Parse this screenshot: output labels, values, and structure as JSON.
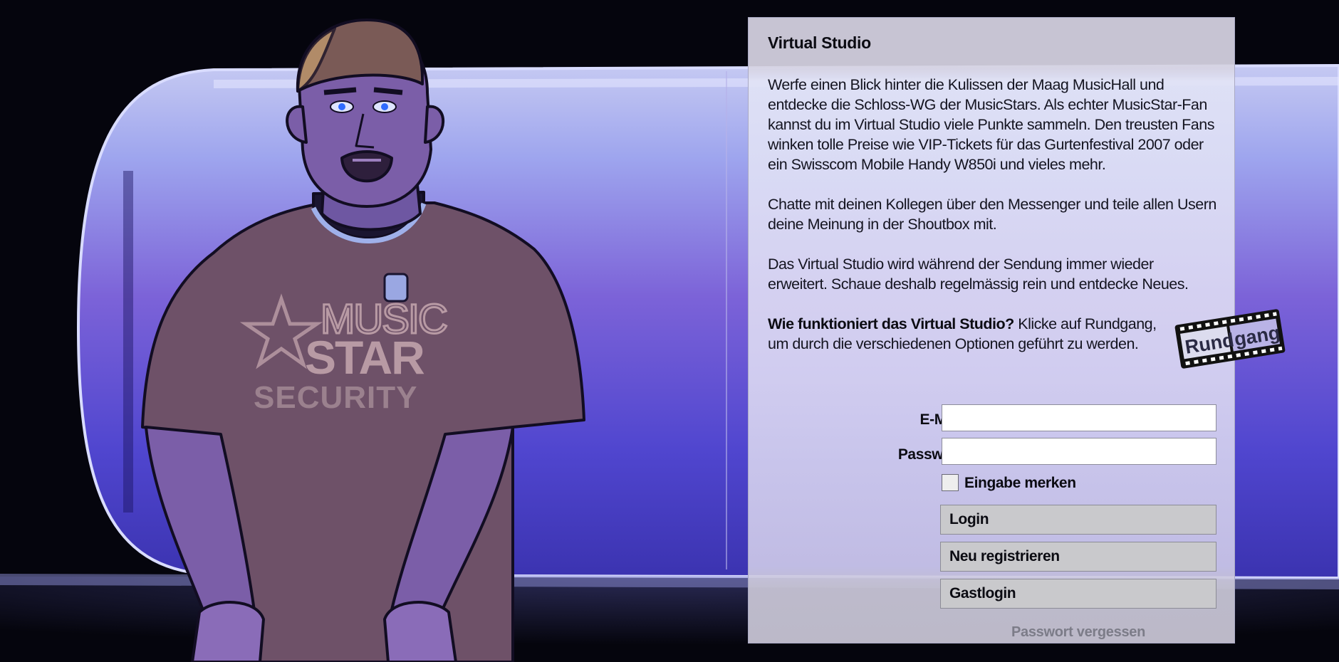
{
  "panel": {
    "title": "Virtual Studio",
    "intro_paragraphs": [
      "Werfe einen Blick hinter die Kulissen der Maag MusicHall und entdecke die Schloss-WG der MusicStars. Als echter MusicStar-Fan kannst du im Virtual Studio viele Punkte sammeln. Den treusten Fans winken tolle Preise wie VIP-Tickets für das Gurtenfestival 2007 oder ein Swisscom Mobile Handy W850i und vieles mehr.",
      "Chatte mit deinen Kollegen über den Messenger und teile allen Usern deine Meinung in der Shoutbox mit.",
      "Das Virtual Studio wird während der Sendung immer wieder erweitert. Schaue deshalb regelmässig rein und entdecke Neues."
    ],
    "howto_question": "Wie funktioniert das Virtual Studio?",
    "howto_text": " Klicke auf  Rundgang, um durch die verschiedenen Optionen geführt zu werden.",
    "rundgang_label_left": "Rund",
    "rundgang_label_right": "gang"
  },
  "login": {
    "email_label": "E-Mail",
    "email_value": "",
    "password_label": "Passwort",
    "password_value": "",
    "remember_label": "Eingabe merken",
    "remember_checked": false,
    "login_button": "Login",
    "register_button": "Neu registrieren",
    "guest_button": "Gastlogin",
    "forgot_link": "Passwort vergessen"
  },
  "mascot": {
    "shirt_line1": "MUSIC",
    "shirt_line2": "STAR",
    "shirt_line3": "SECURITY"
  },
  "colors": {
    "backdrop_dark": "#05050d",
    "band_purple": "#5b4fd6",
    "shirt_brown": "#6e5168",
    "skin_purple": "#7b5ea8",
    "button_gray": "#c9c9cc"
  }
}
